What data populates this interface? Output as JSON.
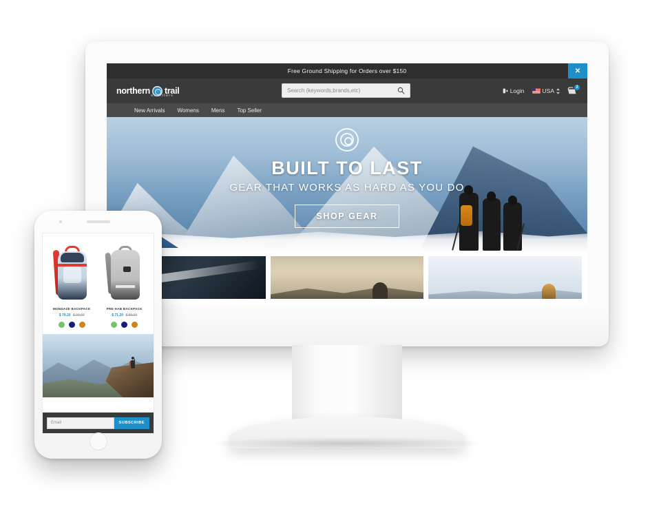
{
  "desktop": {
    "promo": {
      "text": "Free Ground Shipping for Orders over $150",
      "close_label": "✕"
    },
    "brand": {
      "word_one": "northern",
      "word_two": "trail",
      "tagline": "outfitters",
      "mark_icon": "compass-emblem-icon"
    },
    "search": {
      "placeholder": "Search (keywords,brands,etc)",
      "value": "",
      "icon": "search-icon"
    },
    "account": {
      "login_label": "Login",
      "login_icon": "login-arrow-icon",
      "country_label": "USA",
      "country_flag_icon": "us-flag-icon",
      "country_caret_icon": "sort-updown-icon",
      "cart_icon": "shopping-cart-icon",
      "cart_count": "2"
    },
    "nav": [
      {
        "label": "New Arrivals"
      },
      {
        "label": "Womens"
      },
      {
        "label": "Mens"
      },
      {
        "label": "Top Seller"
      }
    ],
    "hero": {
      "emblem_icon": "compass-rosette-icon",
      "title": "BUILT TO LAST",
      "subtitle": "GEAR THAT WORKS AS HARD AS YOU DO",
      "cta_label": "SHOP GEAR"
    },
    "categories": [
      {
        "name": "category-tile-skier"
      },
      {
        "name": "category-tile-desert-sky"
      },
      {
        "name": "category-tile-mountain-light"
      }
    ]
  },
  "phone": {
    "products": [
      {
        "name": "MONDAZE BACKPACK",
        "sale_price": "$ 79.20",
        "old_price": "$ 99.00",
        "colors": [
          "#76c16a",
          "#131f78",
          "#d2821f"
        ]
      },
      {
        "name": "PRE-HAB BACKPACK",
        "sale_price": "$ 71.20",
        "old_price": "$ 89.00",
        "colors": [
          "#76c16a",
          "#131f78",
          "#d2821f"
        ]
      }
    ],
    "hero_image": "hiker-on-cliff-image",
    "subscribe": {
      "placeholder": "Email",
      "value": "",
      "button_label": "SUBSCRIBE"
    }
  },
  "colors": {
    "accent": "#1f8fca",
    "header_dark": "#3a3a3a",
    "promo_dark": "#2e2e2e",
    "nav_dark": "#4a4a4a"
  }
}
